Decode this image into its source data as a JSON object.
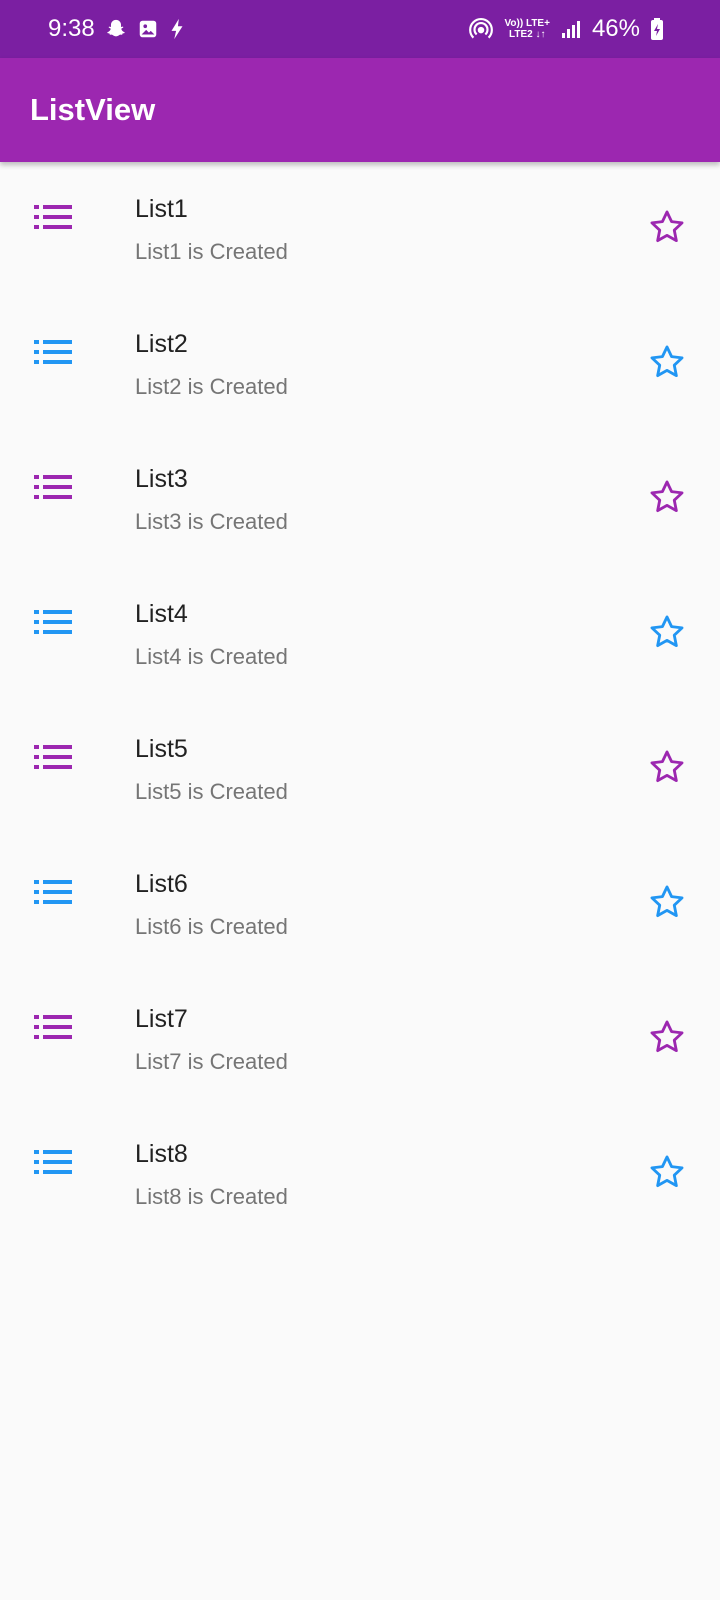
{
  "status_bar": {
    "time": "9:38",
    "network_line1": "Vo)) LTE+",
    "network_line2": "LTE2 ↓↑",
    "battery": "46%",
    "icons": [
      "snapchat-icon",
      "gallery-icon",
      "flash-icon",
      "hotspot-icon",
      "signal-icon",
      "battery-icon"
    ]
  },
  "app_bar": {
    "title": "ListView"
  },
  "colors": {
    "purple": "#9C27B0",
    "blue": "#2196F3",
    "status_bar": "#7B1FA2"
  },
  "items": [
    {
      "title": "List1",
      "subtitle": "List1 is Created",
      "color": "#9C27B0"
    },
    {
      "title": "List2",
      "subtitle": "List2 is Created",
      "color": "#2196F3"
    },
    {
      "title": "List3",
      "subtitle": "List3 is Created",
      "color": "#9C27B0"
    },
    {
      "title": "List4",
      "subtitle": "List4 is Created",
      "color": "#2196F3"
    },
    {
      "title": "List5",
      "subtitle": "List5 is Created",
      "color": "#9C27B0"
    },
    {
      "title": "List6",
      "subtitle": "List6 is Created",
      "color": "#2196F3"
    },
    {
      "title": "List7",
      "subtitle": "List7 is Created",
      "color": "#9C27B0"
    },
    {
      "title": "List8",
      "subtitle": "List8 is Created",
      "color": "#2196F3"
    }
  ]
}
